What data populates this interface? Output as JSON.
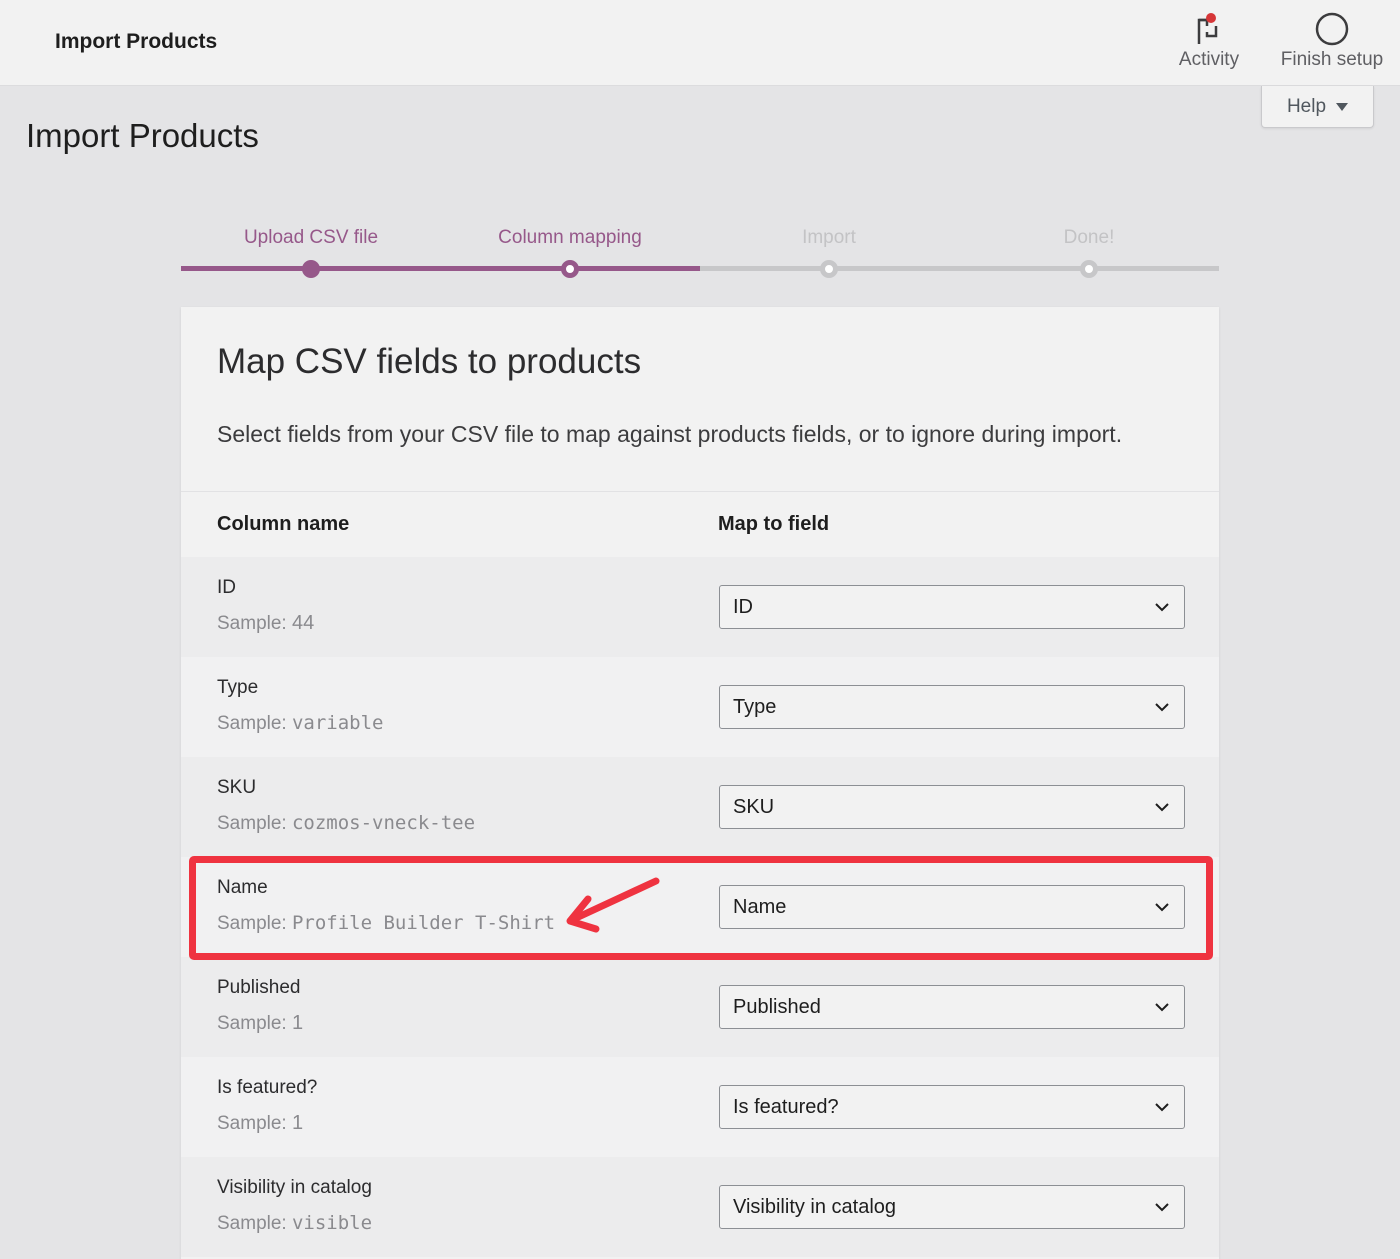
{
  "topbar": {
    "title": "Import Products",
    "actions": [
      {
        "label": "Activity",
        "icon": "flag-icon",
        "has_notification": true
      },
      {
        "label": "Finish setup",
        "icon": "circle-icon"
      }
    ],
    "help": {
      "label": "Help"
    }
  },
  "page": {
    "title": "Import Products"
  },
  "stepper": {
    "steps": [
      {
        "label": "Upload CSV file",
        "state": "done"
      },
      {
        "label": "Column mapping",
        "state": "current"
      },
      {
        "label": "Import",
        "state": "pending"
      },
      {
        "label": "Done!",
        "state": "pending"
      }
    ]
  },
  "card": {
    "title": "Map CSV fields to products",
    "description": "Select fields from your CSV file to map against products fields, or to ignore during import.",
    "columns": {
      "name": "Column name",
      "map": "Map to field"
    },
    "sample_prefix": "Sample:",
    "rows": [
      {
        "name": "ID",
        "sample": "44",
        "mapped": "ID"
      },
      {
        "name": "Type",
        "sample": "variable",
        "mapped": "Type"
      },
      {
        "name": "SKU",
        "sample": "cozmos-vneck-tee",
        "mapped": "SKU"
      },
      {
        "name": "Name",
        "sample": "Profile Builder T-Shirt",
        "mapped": "Name"
      },
      {
        "name": "Published",
        "sample": "1",
        "mapped": "Published"
      },
      {
        "name": "Is featured?",
        "sample": "1",
        "mapped": "Is featured?"
      },
      {
        "name": "Visibility in catalog",
        "sample": "visible",
        "mapped": "Visibility in catalog"
      }
    ]
  },
  "annotation": {
    "highlighted_row": "Name",
    "color": "#ef3340"
  },
  "colors": {
    "accent": "#96588a",
    "inactive": "#c7c7c9",
    "notification": "#d63638"
  }
}
